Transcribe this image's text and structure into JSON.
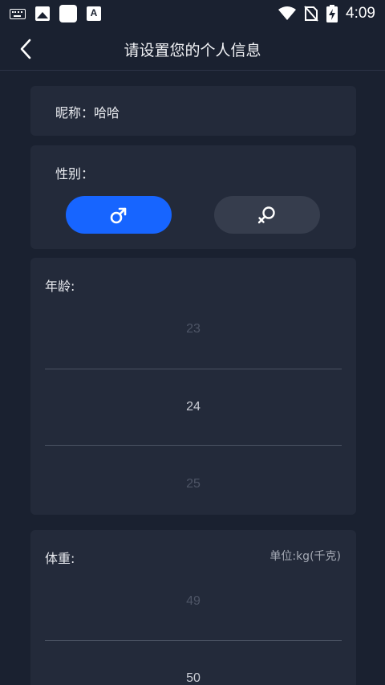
{
  "status_bar": {
    "time": "4:09",
    "left_icons": [
      "keyboard-icon",
      "image-icon",
      "app-square-icon",
      "font-a-icon"
    ],
    "right_icons": [
      "wifi-icon",
      "no-sim-icon",
      "battery-charging-icon"
    ]
  },
  "header": {
    "title": "请设置您的个人信息",
    "back_icon": "chevron-left-icon"
  },
  "nickname": {
    "label": "昵称：",
    "value": "哈哈"
  },
  "gender": {
    "label": "性别：",
    "options": [
      {
        "icon": "male-icon",
        "selected": true,
        "color": "#1765ff"
      },
      {
        "icon": "female-icon",
        "selected": false,
        "color": "#363d4d"
      }
    ]
  },
  "age": {
    "label": "年龄:",
    "values": [
      "23",
      "24",
      "25"
    ],
    "selected": "24"
  },
  "weight": {
    "label": "体重:",
    "unit": "单位:kg(千克)",
    "values": [
      "49",
      "50"
    ],
    "selected": "50"
  },
  "colors": {
    "background": "#1a2130",
    "card": "#232a3a",
    "accent": "#1765ff"
  }
}
